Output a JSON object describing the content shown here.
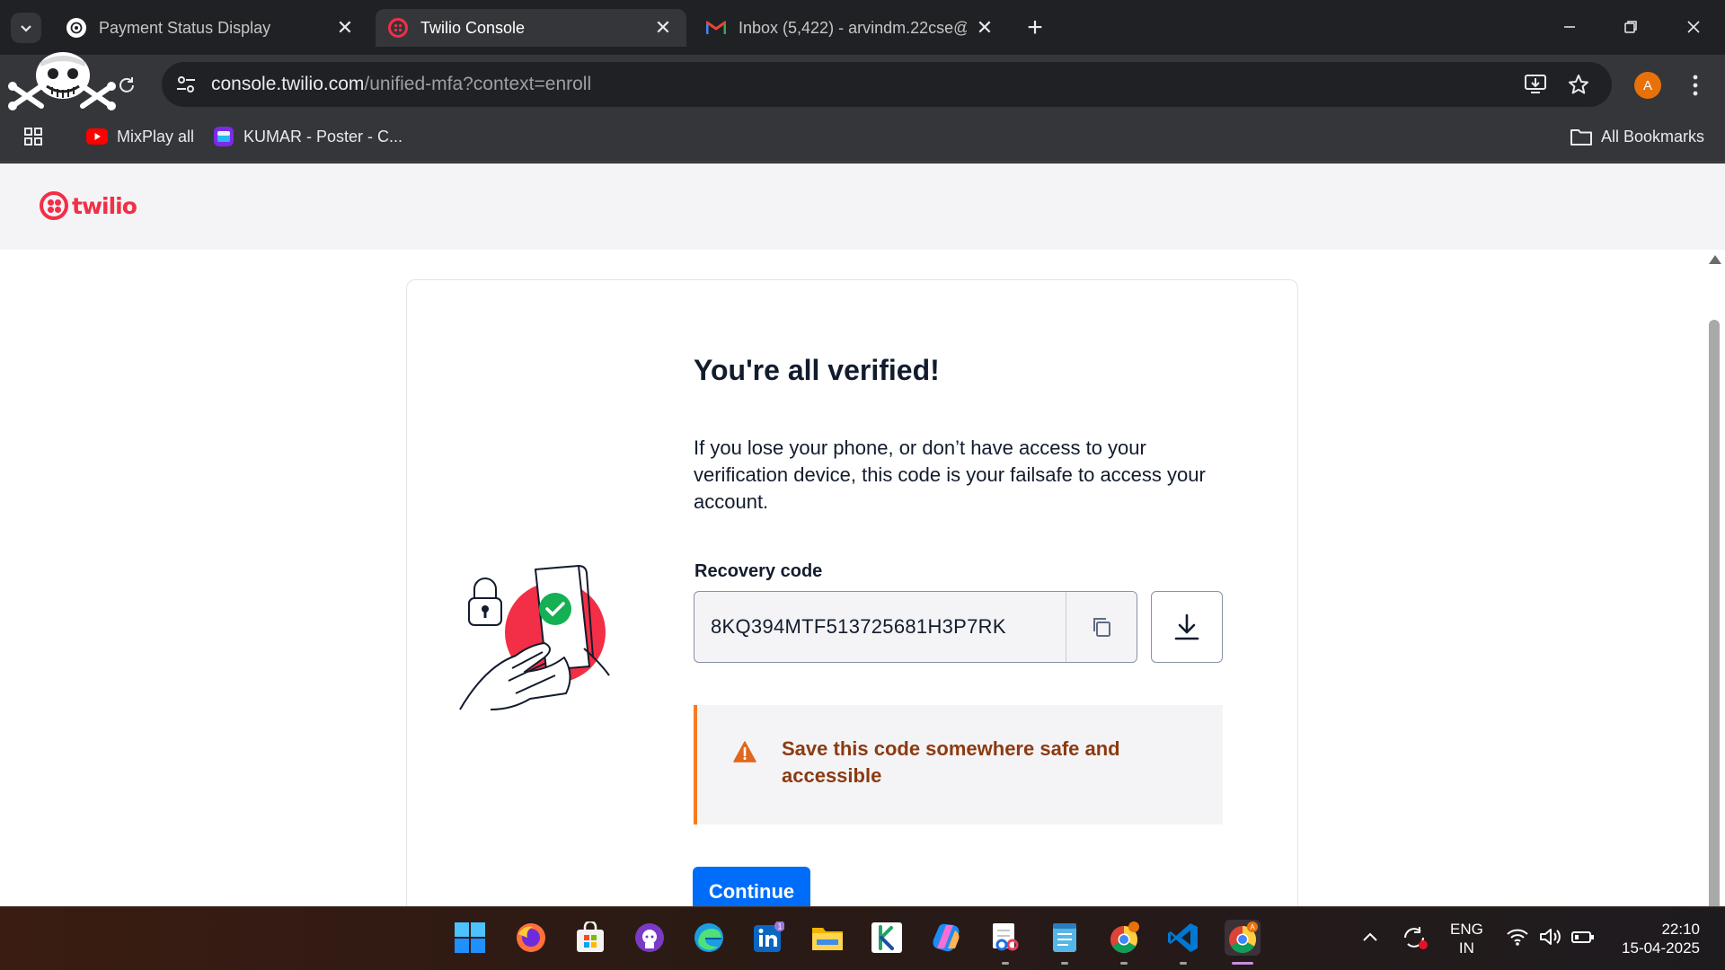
{
  "browser": {
    "tabs": [
      {
        "title": "Payment Status Display",
        "active": false
      },
      {
        "title": "Twilio Console",
        "active": true
      },
      {
        "title": "Inbox (5,422) - arvindm.22cse@",
        "active": false
      }
    ],
    "url_host": "console.twilio.com",
    "url_path": "/unified-mfa?context=enroll",
    "profile_initial": "A",
    "bookmarks": [
      {
        "label": "MixPlay all",
        "icon": "youtube-icon"
      },
      {
        "label": "KUMAR - Poster - C...",
        "icon": "canva-icon"
      }
    ],
    "all_bookmarks_label": "All Bookmarks"
  },
  "page": {
    "brand": "twilio",
    "heading": "You're all verified!",
    "description": "If you lose your phone, or don’t have access to your verification device, this code is your failsafe to access your account.",
    "recovery_label": "Recovery code",
    "recovery_code": "8KQ394MTF513725681H3P7RK",
    "warning": "Save this code somewhere safe and accessible",
    "continue_label": "Continue"
  },
  "taskbar": {
    "apps": [
      "start",
      "firefox",
      "microsoft-store",
      "github-desktop",
      "edge",
      "linkedin",
      "file-explorer",
      "kite",
      "copilot",
      "snipping-tool",
      "notepad",
      "chrome",
      "vscode",
      "chrome"
    ],
    "linkedin_badge": "1",
    "chrome_badge": "A",
    "language_line1": "ENG",
    "language_line2": "IN",
    "time": "22:10",
    "date": "15-04-2025"
  },
  "colors": {
    "twilio_red": "#f22f46",
    "primary_blue": "#006dfa",
    "warning_orange": "#f47c22",
    "warning_text": "#8c3a11",
    "chrome_dark": "#202124"
  }
}
